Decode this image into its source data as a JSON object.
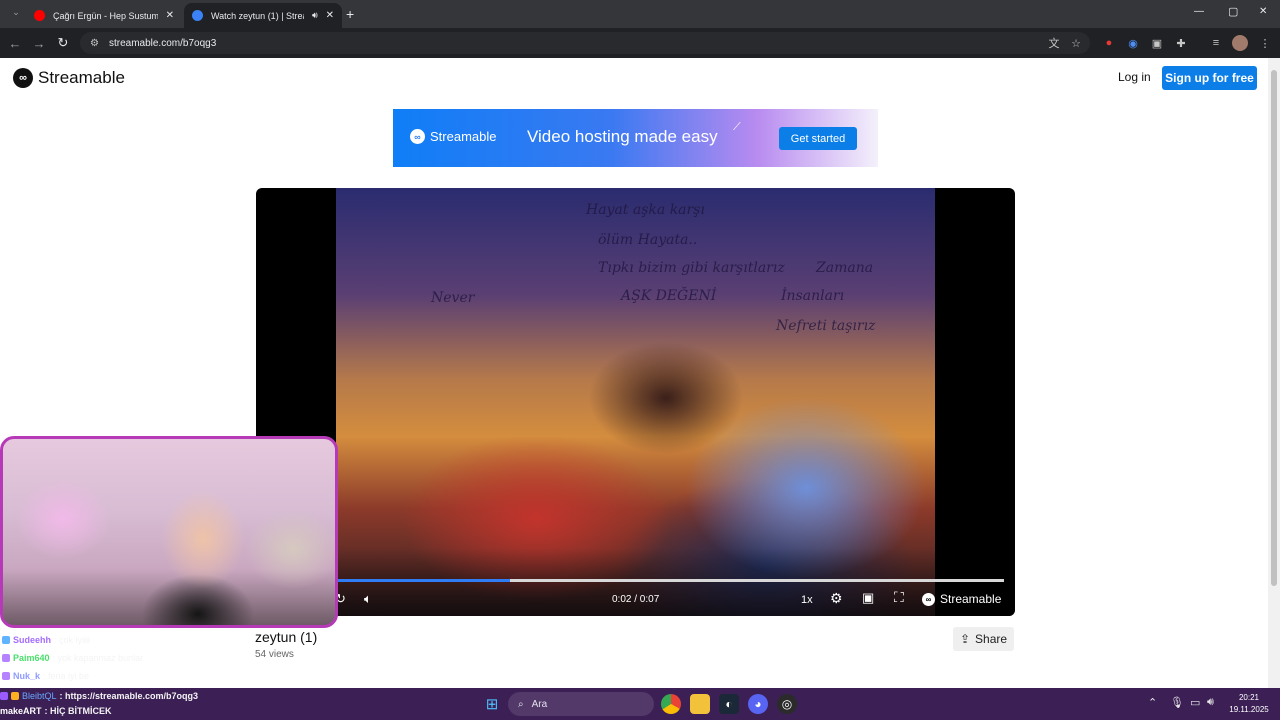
{
  "browser": {
    "tabs": [
      {
        "title": "Çağrı Ergün - Hep Sustum (Aral",
        "favicon": "youtube-icon",
        "active": false
      },
      {
        "title": "Watch zeytun (1) | Streamab",
        "favicon": "streamable-icon",
        "active": true
      }
    ],
    "new_tab": "+",
    "url": "streamable.com/b7oqg3",
    "window_controls": {
      "minimize": "—",
      "maximize": "▢",
      "close": "✕"
    }
  },
  "header": {
    "brand": "Streamable",
    "login": "Log in",
    "signup": "Sign up for free"
  },
  "banner": {
    "brand": "Streamable",
    "tagline": "Video hosting made easy",
    "cta": "Get started"
  },
  "player": {
    "time": "0:02 / 0:07",
    "speed": "1x",
    "brand": "Streamable",
    "progress_fraction": 0.26,
    "scrawls": [
      "Hayat aşka karşı",
      "ölüm Hayata..",
      "Tıpkı bizim gibi karşıtlarız",
      "Zamana",
      "AŞK DEĞENİ",
      "İnsanları",
      "Nefreti taşırız",
      "Never"
    ]
  },
  "video": {
    "title": "zeytun (1)",
    "views": "54 views",
    "share": "Share"
  },
  "stream": {
    "chat": [
      {
        "user": "Sudeehh",
        "user_color": "#a66cff",
        "message": ": çok iyiiii"
      },
      {
        "user": "Paim640",
        "user_color": "#4ade6b",
        "message": ": yok kapanmaz bunlar"
      },
      {
        "user": "Nuk_k",
        "user_color": "#8f9cff",
        "message": ": fena iyi be"
      },
      {
        "user": "BleibtQL",
        "user_color": "#6aa7ff",
        "message": ": https://streamable.com/b7oqg3"
      },
      {
        "user": "makeART",
        "user_color": "#ffffff",
        "message": ": HİÇ BİTMİCEK"
      }
    ]
  },
  "taskbar": {
    "search": "Ara",
    "time": "20:21",
    "date": "19.11.2025"
  },
  "colors": {
    "accent": "#0c7ee8",
    "taskbar": "#3b1f55",
    "webcam_border": "#b63ab8"
  }
}
